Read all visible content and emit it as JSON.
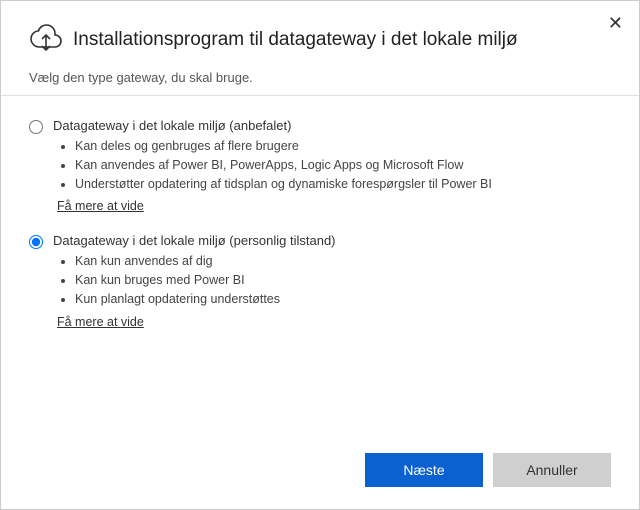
{
  "window": {
    "title": "Installationsprogram til datagateway i det lokale miljø",
    "subtitle": "Vælg den type gateway, du skal bruge."
  },
  "options": [
    {
      "id": "recommended",
      "label": "Datagateway i det lokale miljø (anbefalet)",
      "selected": false,
      "bullets": [
        "Kan deles og genbruges af flere brugere",
        "Kan anvendes af Power BI, PowerApps, Logic Apps og Microsoft Flow",
        "Understøtter opdatering af tidsplan og dynamiske forespørgsler til Power BI"
      ],
      "learn_more": "Få mere at vide"
    },
    {
      "id": "personal",
      "label": "Datagateway i det lokale miljø (personlig tilstand)",
      "selected": true,
      "bullets": [
        "Kan kun anvendes af dig",
        "Kan kun bruges med Power BI",
        "Kun planlagt opdatering understøttes"
      ],
      "learn_more": "Få mere at vide"
    }
  ],
  "footer": {
    "next": "Næste",
    "cancel": "Annuller"
  }
}
